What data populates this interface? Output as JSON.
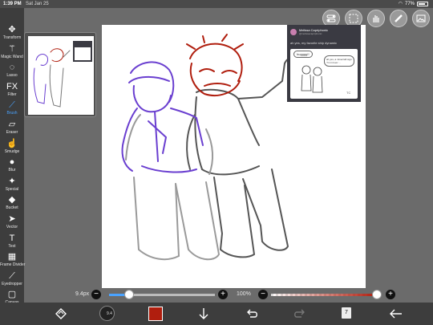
{
  "status_bar": {
    "time": "1:39 PM",
    "date": "Sat Jan 25",
    "battery": "77%",
    "battery_level": 0.77
  },
  "tools": [
    {
      "name": "transform",
      "label": "Transform",
      "icon": "move-arrows-icon"
    },
    {
      "name": "magic-wand",
      "label": "Magic Wand",
      "icon": "magic-wand-icon"
    },
    {
      "name": "lasso",
      "label": "Lasso",
      "icon": "lasso-icon"
    },
    {
      "name": "filter",
      "label": "Filter",
      "icon": "fx-icon"
    },
    {
      "name": "brush",
      "label": "Brush",
      "icon": "brush-icon",
      "active": true
    },
    {
      "name": "eraser",
      "label": "Eraser",
      "icon": "eraser-icon"
    },
    {
      "name": "smudge",
      "label": "Smudge",
      "icon": "smudge-icon"
    },
    {
      "name": "blur",
      "label": "Blur",
      "icon": "blur-drop-icon"
    },
    {
      "name": "special",
      "label": "Special",
      "icon": "special-icon"
    },
    {
      "name": "bucket",
      "label": "Bucket",
      "icon": "bucket-icon"
    },
    {
      "name": "vector",
      "label": "Vector",
      "icon": "vector-arrow-icon"
    },
    {
      "name": "text",
      "label": "Text",
      "icon": "text-icon"
    },
    {
      "name": "frame-divider",
      "label": "Frame Divider",
      "icon": "frame-divider-icon"
    },
    {
      "name": "eyedropper",
      "label": "Eyedropper",
      "icon": "eyedropper-icon"
    },
    {
      "name": "canvas",
      "label": "Canvas",
      "icon": "canvas-icon"
    }
  ],
  "reference": {
    "name": "Melissa Capriphonic",
    "handle": "@melissacapriphonic",
    "text": "ah yes, my favorite ship dynamic",
    "bubble_left": "hugggg!!",
    "bubble_right": "ah yes, a minecraft sign 'I'm in love' ...",
    "signature": "TC"
  },
  "brush_size": {
    "label": "9.4px",
    "value_fraction": 0.19
  },
  "opacity": {
    "label": "100%",
    "value_fraction": 1.0
  },
  "bottom_bar": {
    "brush_size_preview": "9.4",
    "current_color": "#b01e0e",
    "layer_count": "7"
  },
  "colors": {
    "accent": "#4aa3ff",
    "purple_sketch": "#6a3fd0",
    "red_sketch": "#b01e0e"
  }
}
